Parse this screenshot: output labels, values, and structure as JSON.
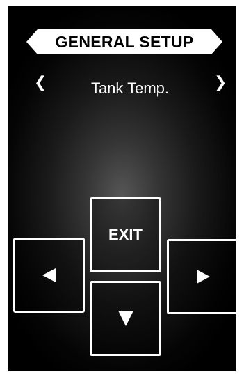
{
  "header": {
    "title": "GENERAL SETUP"
  },
  "selector": {
    "prev_icon": "chevron-left-icon",
    "next_icon": "chevron-right-icon",
    "prev_glyph": "❮",
    "next_glyph": "❯",
    "current_label": "Tank Temp."
  },
  "keypad": {
    "exit_label": "EXIT",
    "left_icon": "triangle-left-icon",
    "right_icon": "triangle-right-icon",
    "down_icon": "triangle-down-icon"
  },
  "colors": {
    "foreground": "#ffffff",
    "background": "#000000"
  }
}
